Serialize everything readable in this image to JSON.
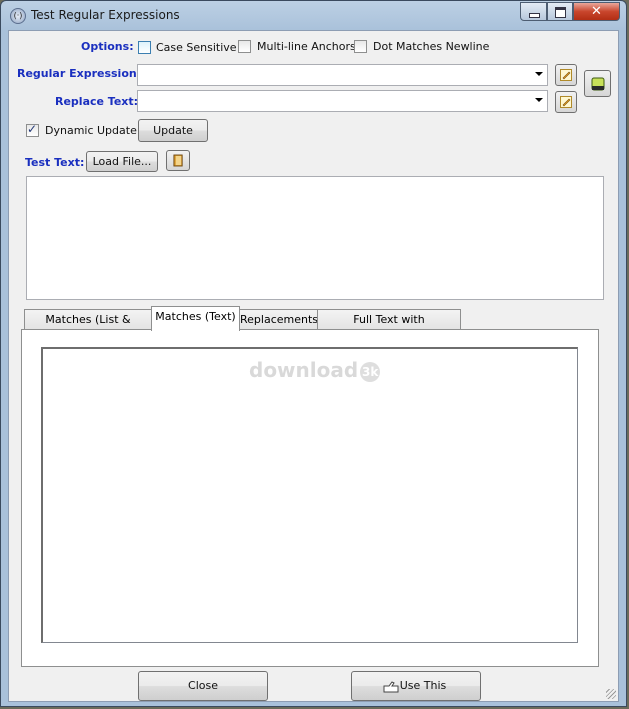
{
  "window": {
    "title": "Test Regular Expressions",
    "icon": "(·)",
    "close_glyph": "✕"
  },
  "options": {
    "label": "Options:",
    "case_sensitive": {
      "label": "Case Sensitive",
      "checked": false
    },
    "multiline_anchors": {
      "label": "Multi-line Anchors",
      "checked": false
    },
    "dot_matches_newline": {
      "label": "Dot Matches Newline",
      "checked": false
    }
  },
  "regex": {
    "label": "Regular Expression:",
    "value": ""
  },
  "replace": {
    "label": "Replace Text:",
    "value": ""
  },
  "dynamic_update": {
    "label": "Dynamic Update",
    "checked": true
  },
  "update_button": "Update",
  "test_text": {
    "label": "Test Text:",
    "load_button": "Load File...",
    "value": ""
  },
  "tabs": [
    {
      "label": "Matches (List & Groups)",
      "active": false
    },
    {
      "label": "Matches (Text)",
      "active": true
    },
    {
      "label": "Replacements",
      "active": false
    },
    {
      "label": "Full Text with Replacements",
      "active": false
    }
  ],
  "watermark": {
    "text": "download",
    "badge": "3k"
  },
  "footer": {
    "close_button": "Close",
    "use_this_button": "Use This"
  },
  "colors": {
    "label_blue": "#1a2fbf",
    "title_bar": "#a9c1da",
    "close_red": "#c9462d"
  }
}
